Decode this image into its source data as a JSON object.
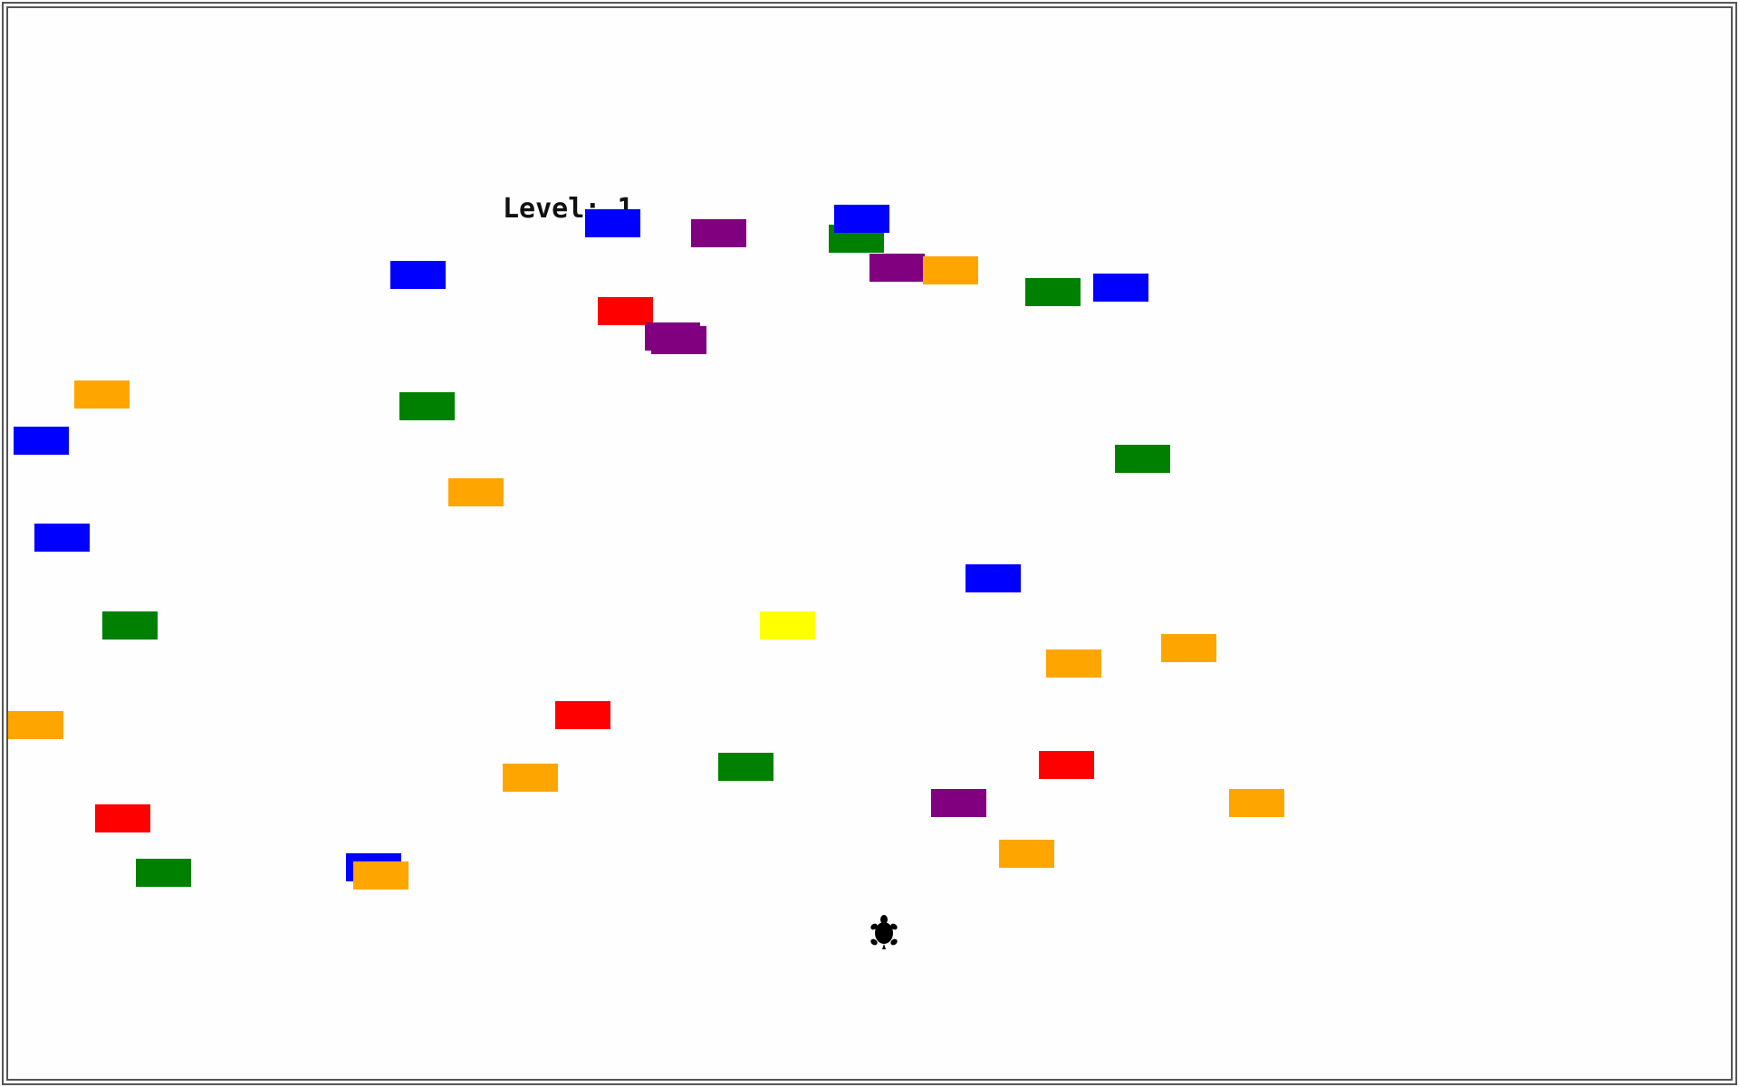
{
  "window": {
    "border_color": "#555555",
    "background": "#ffffff"
  },
  "hud": {
    "level_text": "Level: 1"
  },
  "colors": {
    "blue": "#0000ff",
    "purple": "#800080",
    "green": "#008000",
    "orange": "#ffa500",
    "red": "#ff0000",
    "yellow": "#ffff00",
    "turtle": "#000000"
  },
  "blocks": [
    "blue",
    "purple",
    "green",
    "blue",
    "purple",
    "orange",
    "blue",
    "green",
    "blue",
    "red",
    "purple",
    "purple",
    "orange",
    "green",
    "blue",
    "green",
    "orange",
    "blue",
    "blue",
    "yellow",
    "green",
    "orange",
    "orange",
    "orange",
    "red",
    "green",
    "red",
    "orange",
    "purple",
    "orange",
    "red",
    "orange",
    "green",
    "blue",
    "orange"
  ],
  "player": {
    "icon": "turtle-icon"
  }
}
